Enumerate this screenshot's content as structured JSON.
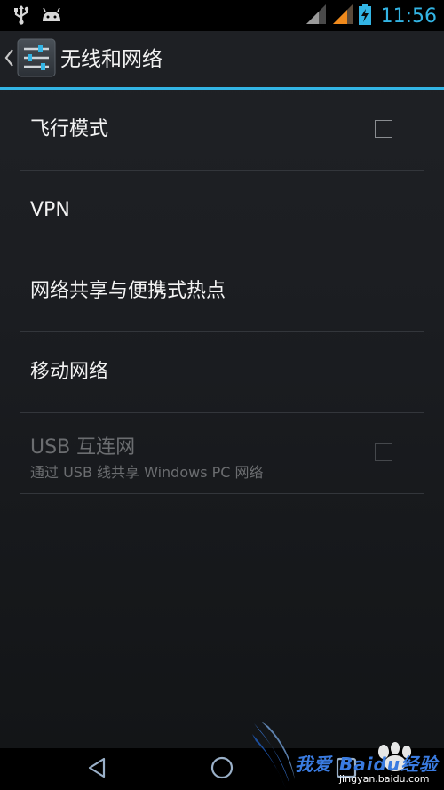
{
  "status_bar": {
    "left_icons": [
      "usb-icon",
      "android-icon"
    ],
    "right_icons": [
      "signal-icon",
      "signal-orange-icon",
      "battery-charging-icon"
    ],
    "time": "11:56",
    "accent_color": "#33b5e5",
    "signal_color_orange": "#f08a1c"
  },
  "action_bar": {
    "title": "无线和网络",
    "app_icon": "settings-sliders-icon"
  },
  "settings": {
    "items": [
      {
        "title": "飞行模式",
        "has_checkbox": true,
        "checked": false,
        "enabled": true
      },
      {
        "title": "VPN",
        "has_checkbox": false,
        "enabled": true
      },
      {
        "title": "网络共享与便携式热点",
        "has_checkbox": false,
        "enabled": true
      },
      {
        "title": "移动网络",
        "has_checkbox": false,
        "enabled": true
      },
      {
        "title": "USB 互连网",
        "summary": "通过 USB 线共享 Windows PC 网络",
        "has_checkbox": true,
        "checked": false,
        "enabled": false
      }
    ]
  },
  "nav_bar": {
    "buttons": [
      "back-icon",
      "home-icon",
      "recents-icon"
    ]
  },
  "watermark": {
    "text_cn": "我爱 Baidu经验",
    "url": "jingyan.baidu.com"
  }
}
